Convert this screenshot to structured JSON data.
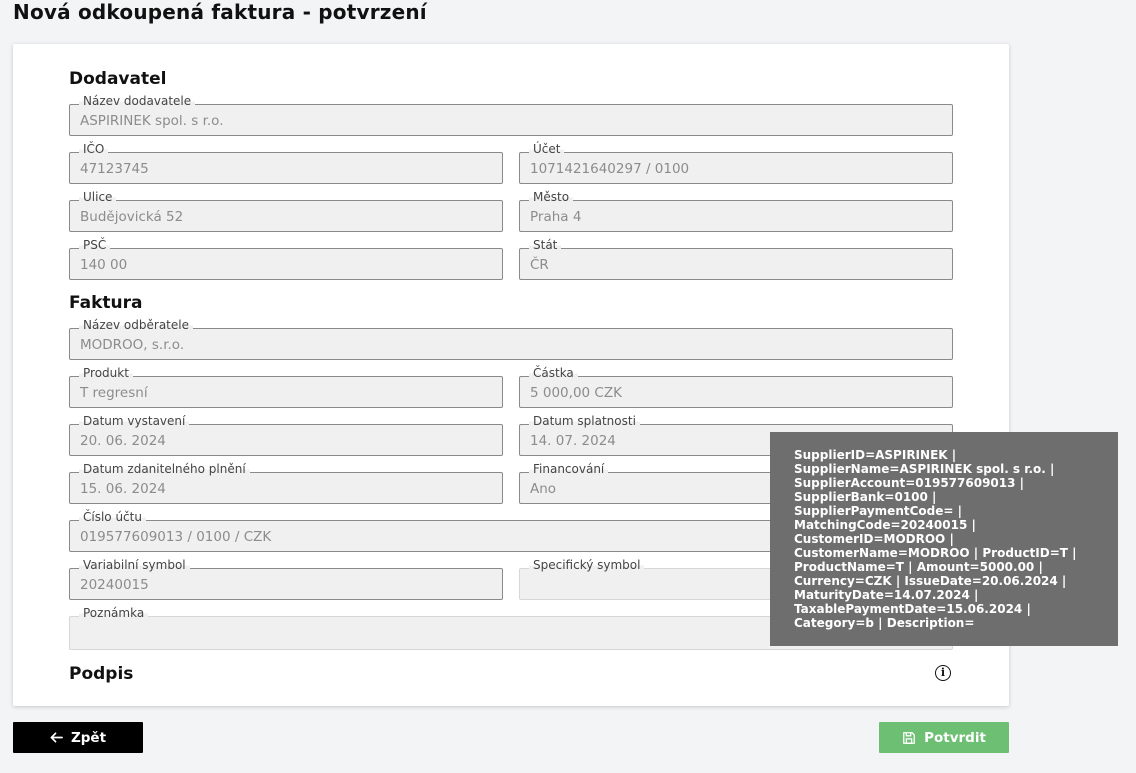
{
  "page_title": "Nová odkoupená faktura - potvrzení",
  "supplier": {
    "section_title": "Dodavatel",
    "fields": {
      "name": {
        "label": "Název dodavatele",
        "value": "ASPIRINEK spol. s r.o."
      },
      "ico": {
        "label": "IČO",
        "value": "47123745"
      },
      "account": {
        "label": "Účet",
        "value": "1071421640297 / 0100"
      },
      "street": {
        "label": "Ulice",
        "value": "Budějovická 52"
      },
      "city": {
        "label": "Město",
        "value": "Praha 4"
      },
      "zip": {
        "label": "PSČ",
        "value": "140 00"
      },
      "country": {
        "label": "Stát",
        "value": "ČR"
      }
    }
  },
  "invoice": {
    "section_title": "Faktura",
    "fields": {
      "customer": {
        "label": "Název odběratele",
        "value": "MODROO, s.r.o."
      },
      "product": {
        "label": "Produkt",
        "value": "T regresní"
      },
      "amount": {
        "label": "Částka",
        "value": "5 000,00 CZK"
      },
      "issue_date": {
        "label": "Datum vystavení",
        "value": "20. 06. 2024"
      },
      "maturity_date": {
        "label": "Datum splatnosti",
        "value": "14. 07. 2024"
      },
      "taxable_date": {
        "label": "Datum zdanitelného plnění",
        "value": "15. 06. 2024"
      },
      "financing": {
        "label": "Financování",
        "value": "Ano"
      },
      "account_number": {
        "label": "Číslo účtu",
        "value": "019577609013 / 0100 / CZK"
      },
      "variable_symbol": {
        "label": "Variabilní symbol",
        "value": "20240015"
      },
      "specific_symbol": {
        "label": "Specifický symbol",
        "value": ""
      },
      "note": {
        "label": "Poznámka",
        "value": ""
      }
    }
  },
  "signature": {
    "section_title": "Podpis",
    "info_icon": "info-icon"
  },
  "tooltip": {
    "lines": [
      "SupplierID=ASPIRINEK |",
      "SupplierName=ASPIRINEK spol. s r.o. |",
      "SupplierAccount=019577609013 |",
      "SupplierBank=0100 |",
      "SupplierPaymentCode= |",
      "MatchingCode=20240015 |",
      "CustomerID=MODROO |",
      "CustomerName=MODROO | ProductID=T |",
      "ProductName=T | Amount=5000.00 |",
      "Currency=CZK | IssueDate=20.06.2024 |",
      "MaturityDate=14.07.2024 |",
      "TaxablePaymentDate=15.06.2024 |",
      "Category=b | Description="
    ]
  },
  "buttons": {
    "back_label": "Zpět",
    "back_icon": "arrow-left-icon",
    "confirm_label": "Potvrdit",
    "confirm_icon": "floppy-disk-icon",
    "confirm_color": "#6dbf73"
  }
}
